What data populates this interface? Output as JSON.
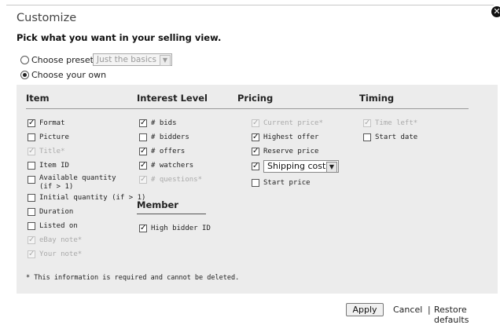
{
  "dialog": {
    "title": "Customize",
    "subtitle": "Pick what you want in your selling view.",
    "close_glyph": "✕"
  },
  "view_mode": {
    "choose_preset_label": "Choose preset",
    "preset_value": "Just the basics",
    "choose_own_label": "Choose your own",
    "selected": "choose_own"
  },
  "columns": {
    "item": {
      "header": "Item",
      "options": [
        {
          "label": "Format",
          "checked": true,
          "disabled": false
        },
        {
          "label": "Picture",
          "checked": false,
          "disabled": false
        },
        {
          "label": "Title*",
          "checked": true,
          "disabled": true
        },
        {
          "label": "Item ID",
          "checked": false,
          "disabled": false
        },
        {
          "label": "Available quantity (if > 1)",
          "checked": false,
          "disabled": false
        },
        {
          "label": "Initial quantity (if > 1)",
          "checked": false,
          "disabled": false
        },
        {
          "label": "Duration",
          "checked": false,
          "disabled": false
        },
        {
          "label": "Listed on",
          "checked": false,
          "disabled": false
        },
        {
          "label": "eBay note*",
          "checked": true,
          "disabled": true
        },
        {
          "label": "Your note*",
          "checked": true,
          "disabled": true
        }
      ]
    },
    "interest": {
      "header": "Interest Level",
      "options": [
        {
          "label": "# bids",
          "checked": true,
          "disabled": false
        },
        {
          "label": "# bidders",
          "checked": false,
          "disabled": false
        },
        {
          "label": "# offers",
          "checked": true,
          "disabled": false
        },
        {
          "label": "# watchers",
          "checked": true,
          "disabled": false
        },
        {
          "label": "# questions*",
          "checked": true,
          "disabled": true
        }
      ]
    },
    "member": {
      "header": "Member",
      "options": [
        {
          "label": "High bidder ID",
          "checked": true,
          "disabled": false
        }
      ]
    },
    "pricing": {
      "header": "Pricing",
      "options": [
        {
          "label": "Current price*",
          "checked": true,
          "disabled": true
        },
        {
          "label": "Highest offer",
          "checked": true,
          "disabled": false
        },
        {
          "label": "Reserve price",
          "checked": true,
          "disabled": false
        },
        {
          "label": "Shipping cost",
          "checked": true,
          "disabled": false
        },
        {
          "label": "Start price",
          "checked": false,
          "disabled": false
        }
      ]
    },
    "timing": {
      "header": "Timing",
      "options": [
        {
          "label": "Time left*",
          "checked": true,
          "disabled": true
        },
        {
          "label": "Start date",
          "checked": false,
          "disabled": false
        }
      ]
    }
  },
  "footnote": "* This information is required and cannot be deleted.",
  "actions": {
    "apply_label": "Apply",
    "cancel_label": "Cancel",
    "separator": "|",
    "restore_label": "Restore defaults"
  }
}
